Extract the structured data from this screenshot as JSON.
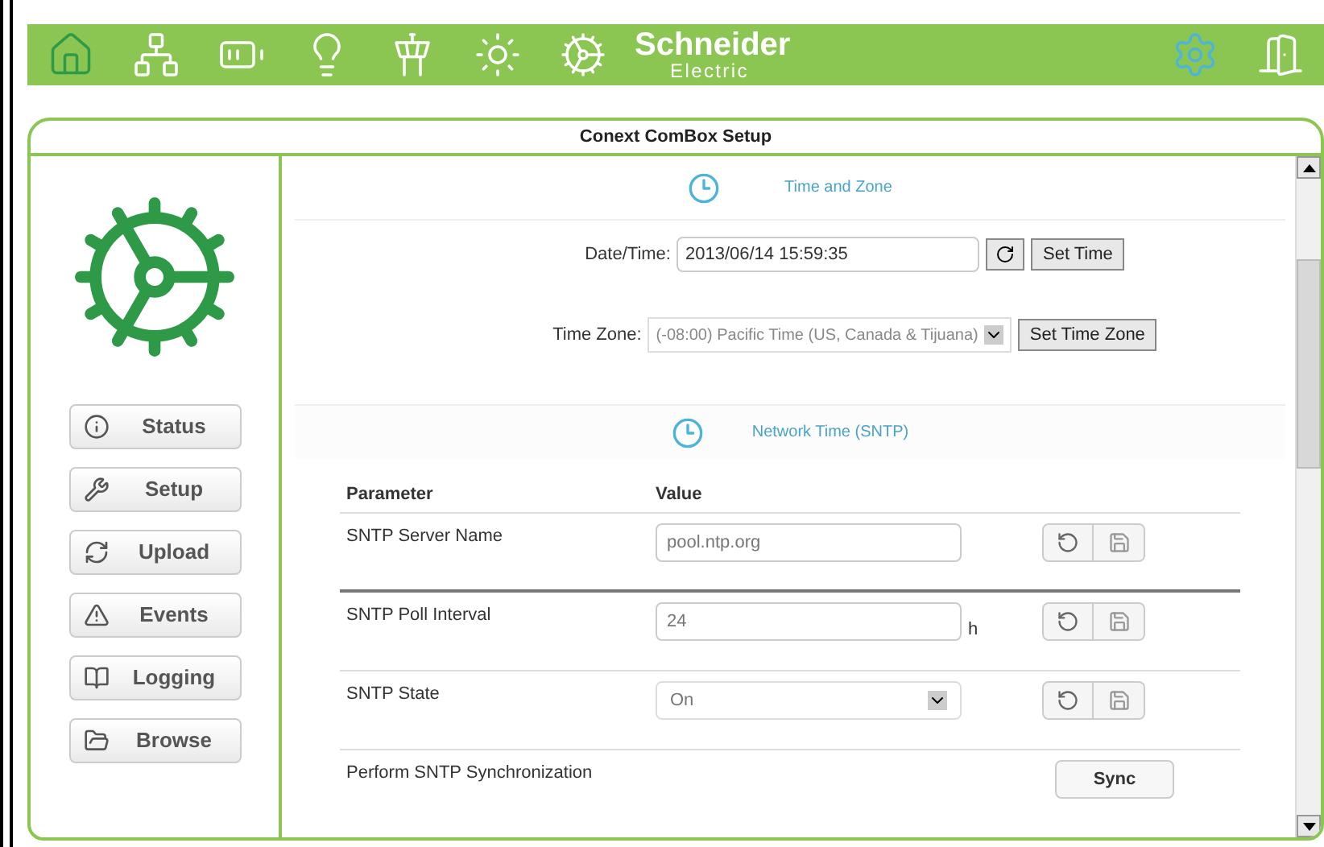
{
  "nav": [
    {
      "kind": "home",
      "selected": false
    },
    {
      "kind": "network",
      "selected": false
    },
    {
      "kind": "battery",
      "selected": false
    },
    {
      "kind": "bulb",
      "selected": false
    },
    {
      "kind": "tower",
      "selected": false
    },
    {
      "kind": "sun",
      "selected": false
    },
    {
      "kind": "generator",
      "selected": false
    },
    {
      "kind": "setup",
      "selected": true
    },
    {
      "kind": "exit",
      "selected": false
    }
  ],
  "brand": {
    "name": "Schneider",
    "sub": "Electric"
  },
  "panel": {
    "title": "Conext ComBox Setup"
  },
  "sidebar": [
    {
      "kind": "info",
      "label": "Status"
    },
    {
      "kind": "tools",
      "label": "Setup"
    },
    {
      "kind": "upload",
      "label": "Upload"
    },
    {
      "kind": "warning",
      "label": "Events"
    },
    {
      "kind": "book",
      "label": "Logging"
    },
    {
      "kind": "folder",
      "label": "Browse"
    }
  ],
  "time_zone_section": {
    "title": "Time and Zone",
    "date_label": "Date/Time:",
    "date_value": "2013/06/14 15:59:35",
    "set_time": "Set Time",
    "zone_label": "Time Zone:",
    "zone_value": "(-08:00) Pacific Time (US, Canada & Tijuana)",
    "set_zone": "Set Time Zone"
  },
  "sntp_section": {
    "title": "Network Time (SNTP)",
    "columns": [
      "Parameter",
      "Value"
    ],
    "rows": [
      {
        "kind": "text",
        "name": "SNTP Server Name",
        "value": "pool.ntp.org"
      },
      {
        "kind": "text",
        "name": "SNTP Poll Interval",
        "value": "24",
        "unit": "h"
      },
      {
        "kind": "select",
        "name": "SNTP State",
        "value": "On"
      },
      {
        "kind": "action",
        "name": "Perform SNTP Synchronization",
        "button": "Sync"
      }
    ]
  }
}
